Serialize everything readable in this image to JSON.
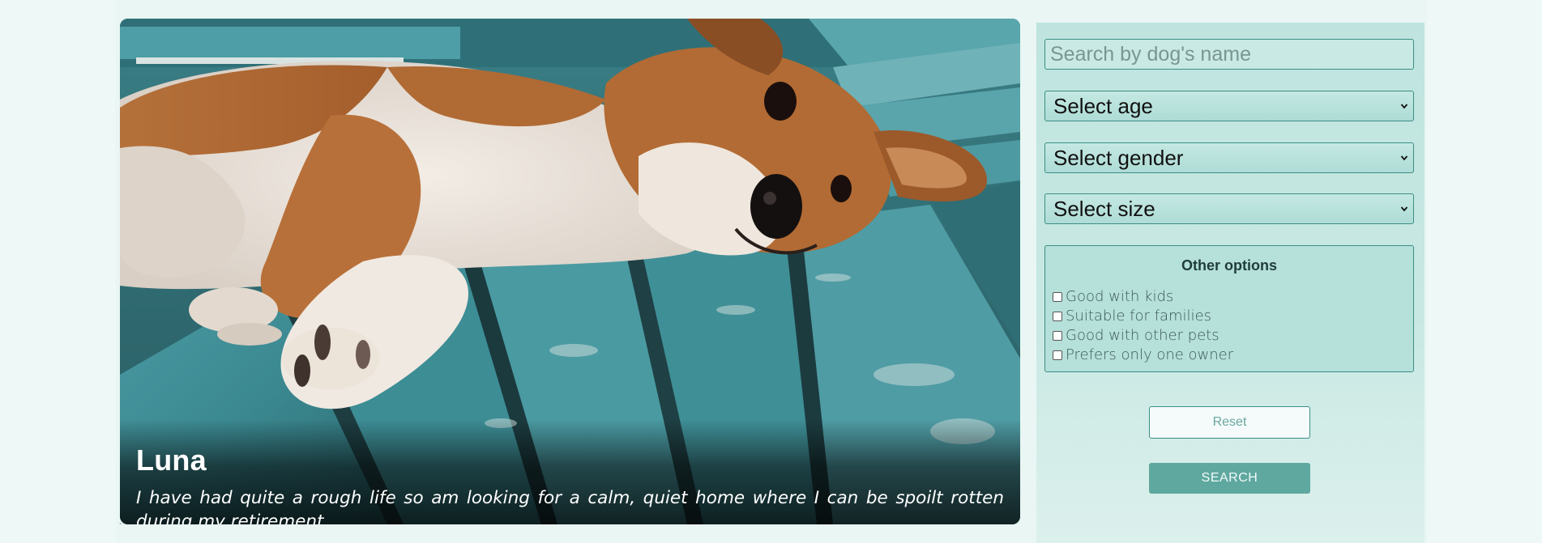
{
  "hero": {
    "image_description_icon": "dog-photo",
    "dog_name": "Luna",
    "description": "I have had quite a rough life so am looking for a calm, quiet home where I can be spoilt rotten during my retirement."
  },
  "filters": {
    "search_placeholder": "Search by dog's name",
    "age_select": "Select age",
    "gender_select": "Select gender",
    "size_select": "Select size",
    "other_options": {
      "title": "Other options",
      "items": [
        {
          "label": "Good with kids",
          "checked": false
        },
        {
          "label": "Suitable for families",
          "checked": false
        },
        {
          "label": "Good with other pets",
          "checked": false
        },
        {
          "label": "Prefers only one owner",
          "checked": false
        }
      ]
    },
    "reset_label": "Reset",
    "search_label": "SEARCH"
  },
  "footer_mark": "`",
  "colors": {
    "page_bg": "#eef8f6",
    "panel_bg": "#c5e7e2",
    "accent": "#5fa8a0",
    "border": "#3b8e85"
  }
}
